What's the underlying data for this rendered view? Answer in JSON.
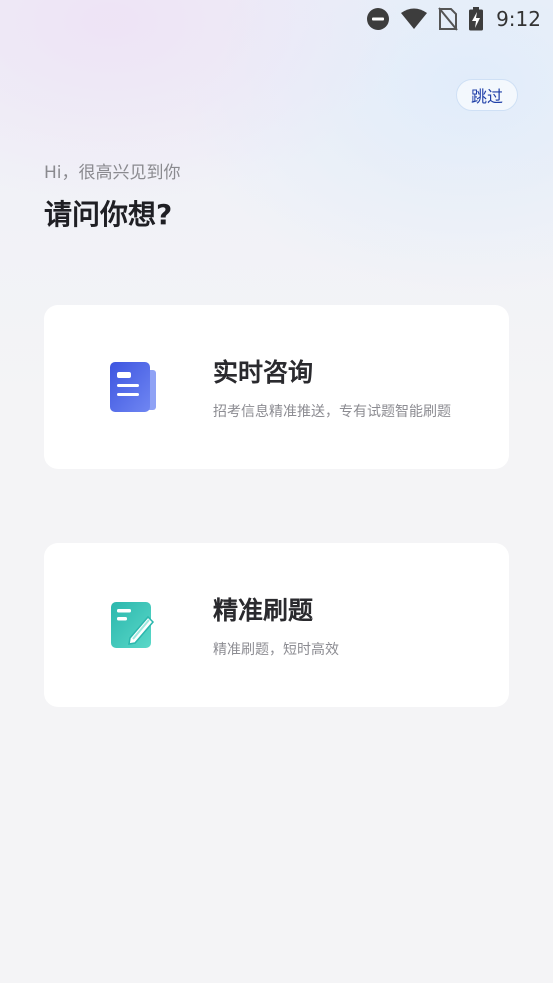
{
  "status_bar": {
    "time": "9:12",
    "icons": [
      "do-not-disturb-icon",
      "wifi-icon",
      "no-sim-icon",
      "battery-charging-icon"
    ]
  },
  "header": {
    "skip_label": "跳过"
  },
  "intro": {
    "greeting": "Hi，很高兴见到你",
    "question": "请问你想?"
  },
  "options": [
    {
      "title": "实时咨询",
      "description": "招考信息精准推送，专有试题智能刷题",
      "icon": "news-document-icon",
      "accent": "#4a63e6"
    },
    {
      "title": "精准刷题",
      "description": "精准刷题，短时高效",
      "icon": "edit-notebook-icon",
      "accent": "#33c2b8"
    }
  ]
}
